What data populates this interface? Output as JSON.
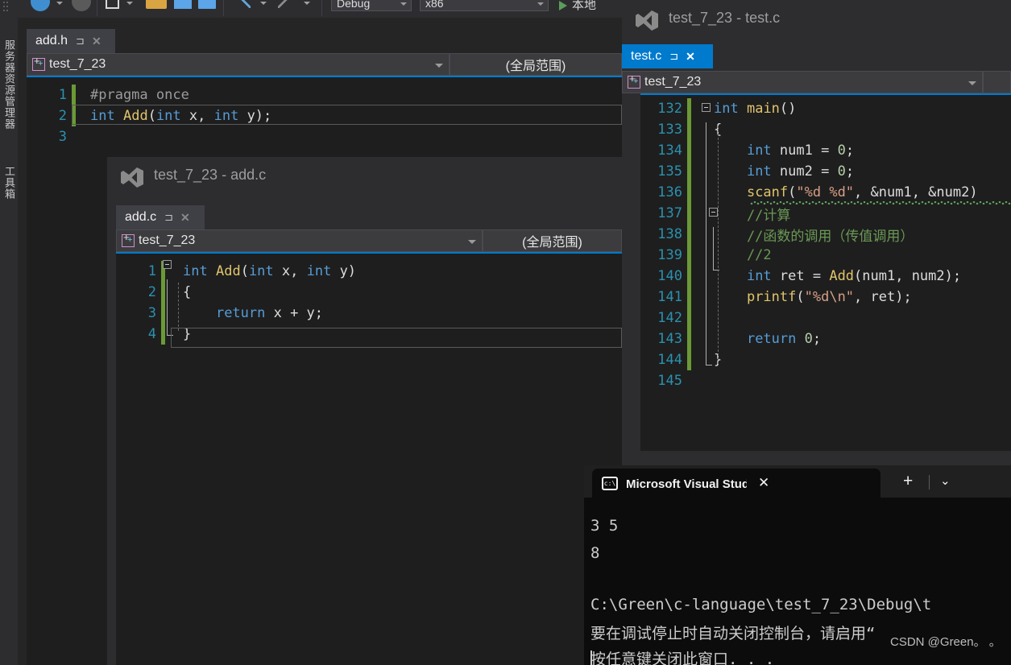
{
  "toolbar": {
    "config_value": "Debug",
    "platform_value": "x86",
    "run_label": "本地",
    "icons": [
      "back-arrow-icon",
      "forward-arrow-icon",
      "new-item-icon",
      "open-folder-icon",
      "save-icon",
      "save-all-icon",
      "undo-icon",
      "redo-icon"
    ]
  },
  "dock": {
    "tabs": [
      {
        "label": "服务器资源管理器"
      },
      {
        "label": "工具箱"
      }
    ]
  },
  "addh_window": {
    "tab": {
      "label": "add.h",
      "pin": "⊐",
      "close": "✕"
    },
    "nav": {
      "project": "test_7_23",
      "scope": "(全局范围)"
    },
    "code": [
      {
        "num": "1",
        "changed": true,
        "tokens": [
          {
            "t": "#pragma once",
            "c": "pp"
          }
        ]
      },
      {
        "num": "2",
        "changed": true,
        "tokens": [
          {
            "t": "int",
            "c": "k"
          },
          {
            "t": " ",
            "c": "id"
          },
          {
            "t": "Add",
            "c": "fn"
          },
          {
            "t": "(",
            "c": "id"
          },
          {
            "t": "int",
            "c": "k"
          },
          {
            "t": " x, ",
            "c": "id"
          },
          {
            "t": "int",
            "c": "k"
          },
          {
            "t": " y);",
            "c": "id"
          }
        ]
      },
      {
        "num": "3",
        "changed": false,
        "tokens": []
      }
    ]
  },
  "addc_window": {
    "title": "test_7_23 - add.c",
    "tab": {
      "label": "add.c",
      "pin": "⊐",
      "close": "✕"
    },
    "nav": {
      "project": "test_7_23",
      "scope": "(全局范围)"
    },
    "code": [
      {
        "num": "1",
        "changed": true,
        "tokens": [
          {
            "t": "int",
            "c": "k"
          },
          {
            "t": " ",
            "c": "id"
          },
          {
            "t": "Add",
            "c": "fn"
          },
          {
            "t": "(",
            "c": "id"
          },
          {
            "t": "int",
            "c": "k"
          },
          {
            "t": " x, ",
            "c": "id"
          },
          {
            "t": "int",
            "c": "k"
          },
          {
            "t": " y)",
            "c": "id"
          }
        ]
      },
      {
        "num": "2",
        "changed": true,
        "tokens": [
          {
            "t": "{",
            "c": "id"
          }
        ]
      },
      {
        "num": "3",
        "changed": true,
        "tokens": [
          {
            "t": "    ",
            "c": "id"
          },
          {
            "t": "return",
            "c": "k"
          },
          {
            "t": " x + y;",
            "c": "id"
          }
        ]
      },
      {
        "num": "4",
        "changed": true,
        "tokens": [
          {
            "t": "}",
            "c": "id"
          }
        ]
      }
    ]
  },
  "testc_window": {
    "title": "test_7_23 - test.c",
    "tab": {
      "label": "test.c",
      "pin": "⊐",
      "close": "✕"
    },
    "nav": {
      "project": "test_7_23",
      "scope": ""
    },
    "code": [
      {
        "num": "132",
        "changed": true,
        "tokens": [
          {
            "t": "int",
            "c": "k"
          },
          {
            "t": " ",
            "c": "id"
          },
          {
            "t": "main",
            "c": "fn"
          },
          {
            "t": "()",
            "c": "id"
          }
        ]
      },
      {
        "num": "133",
        "changed": true,
        "tokens": [
          {
            "t": "{",
            "c": "id"
          }
        ]
      },
      {
        "num": "134",
        "changed": true,
        "tokens": [
          {
            "t": "    ",
            "c": "id"
          },
          {
            "t": "int",
            "c": "k"
          },
          {
            "t": " num1 = ",
            "c": "id"
          },
          {
            "t": "0",
            "c": "nm"
          },
          {
            "t": ";",
            "c": "id"
          }
        ]
      },
      {
        "num": "135",
        "changed": true,
        "tokens": [
          {
            "t": "    ",
            "c": "id"
          },
          {
            "t": "int",
            "c": "k"
          },
          {
            "t": " num2 = ",
            "c": "id"
          },
          {
            "t": "0",
            "c": "nm"
          },
          {
            "t": ";",
            "c": "id"
          }
        ]
      },
      {
        "num": "136",
        "changed": true,
        "tokens": [
          {
            "t": "    ",
            "c": "id"
          },
          {
            "t": "scanf",
            "c": "fn"
          },
          {
            "t": "(",
            "c": "id"
          },
          {
            "t": "\"%d %d\"",
            "c": "st"
          },
          {
            "t": ", &num1, &num2)",
            "c": "id"
          }
        ]
      },
      {
        "num": "137",
        "changed": true,
        "tokens": [
          {
            "t": "    //计算",
            "c": "cm"
          }
        ]
      },
      {
        "num": "138",
        "changed": true,
        "tokens": [
          {
            "t": "    //函数的调用（传值调用）",
            "c": "cm"
          }
        ]
      },
      {
        "num": "139",
        "changed": true,
        "tokens": [
          {
            "t": "    //2",
            "c": "cm"
          }
        ]
      },
      {
        "num": "140",
        "changed": true,
        "tokens": [
          {
            "t": "    ",
            "c": "id"
          },
          {
            "t": "int",
            "c": "k"
          },
          {
            "t": " ret = ",
            "c": "id"
          },
          {
            "t": "Add",
            "c": "fn"
          },
          {
            "t": "(num1, num2);",
            "c": "id"
          }
        ]
      },
      {
        "num": "141",
        "changed": true,
        "tokens": [
          {
            "t": "    ",
            "c": "id"
          },
          {
            "t": "printf",
            "c": "fn"
          },
          {
            "t": "(",
            "c": "id"
          },
          {
            "t": "\"%d\\n\"",
            "c": "st"
          },
          {
            "t": ", ret);",
            "c": "id"
          }
        ]
      },
      {
        "num": "142",
        "changed": true,
        "tokens": []
      },
      {
        "num": "143",
        "changed": true,
        "tokens": [
          {
            "t": "    ",
            "c": "id"
          },
          {
            "t": "return",
            "c": "k"
          },
          {
            "t": " ",
            "c": "id"
          },
          {
            "t": "0",
            "c": "nm"
          },
          {
            "t": ";",
            "c": "id"
          }
        ]
      },
      {
        "num": "144",
        "changed": true,
        "tokens": [
          {
            "t": "}",
            "c": "id"
          }
        ]
      },
      {
        "num": "145",
        "changed": false,
        "tokens": []
      }
    ]
  },
  "console": {
    "tab_title": "Microsoft Visual Studio 调试控",
    "tab_icon": "console-icon",
    "close_label": "✕",
    "new_tab_label": "+",
    "dropdown_label": "⌄",
    "lines": [
      "3 5",
      "8",
      "",
      "C:\\Green\\c-language\\test_7_23\\Debug\\t",
      "要在调试停止时自动关闭控制台，请启用“",
      "按任意键关闭此窗口. . ."
    ],
    "watermark": "CSDN @Green。 。"
  },
  "colors": {
    "accent": "#007acc",
    "editor_bg": "#1e1e1e",
    "chrome_bg": "#2d2d30",
    "saved_marker": "#6a9a35",
    "console_bg": "#0c0c0c"
  }
}
